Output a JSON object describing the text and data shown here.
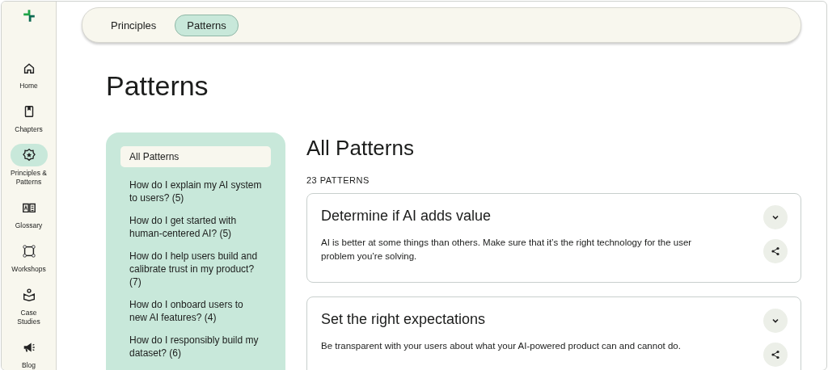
{
  "nav": [
    {
      "label": "Home",
      "selected": false
    },
    {
      "label": "Chapters",
      "selected": false
    },
    {
      "label": "Principles & Patterns",
      "selected": true
    },
    {
      "label": "Glossary",
      "selected": false
    },
    {
      "label": "Workshops",
      "selected": false
    },
    {
      "label": "Case Studies",
      "selected": false
    },
    {
      "label": "Blog",
      "selected": false
    }
  ],
  "tabs": [
    {
      "label": "Principles",
      "selected": false
    },
    {
      "label": "Patterns",
      "selected": true
    }
  ],
  "page_title": "Patterns",
  "filters": [
    {
      "label": "All Patterns",
      "selected": true
    },
    {
      "label": "How do I explain my AI system to users? (5)",
      "selected": false
    },
    {
      "label": "How do I get started with human-centered AI? (5)",
      "selected": false
    },
    {
      "label": "How do I help users build and calibrate trust in my product? (7)",
      "selected": false
    },
    {
      "label": "How do I onboard users to new AI features? (4)",
      "selected": false
    },
    {
      "label": "How do I responsibly build my dataset? (6)",
      "selected": false
    }
  ],
  "section_title": "All Patterns",
  "count": "23 PATTERNS",
  "patterns": [
    {
      "title": "Determine if AI adds value",
      "text": "AI is better at some things than others. Make sure that it’s the right technology for the user problem you’re solving."
    },
    {
      "title": "Set the right expectations",
      "text": "Be transparent with your users about what your AI-powered product can and cannot do."
    }
  ]
}
